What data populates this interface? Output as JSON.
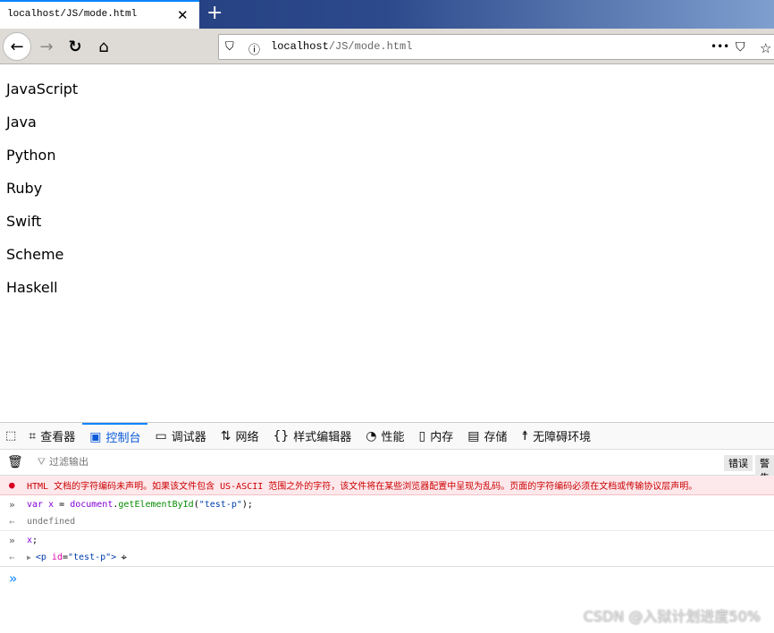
{
  "browser": {
    "tab_title": "localhost/JS/mode.html",
    "url_host": "localhost",
    "url_path": "/JS/mode.html"
  },
  "page": {
    "items": [
      "JavaScript",
      "Java",
      "Python",
      "Ruby",
      "Swift",
      "Scheme",
      "Haskell"
    ]
  },
  "devtools": {
    "tabs": [
      {
        "label": "查看器",
        "icon": "inspector-icon"
      },
      {
        "label": "控制台",
        "icon": "console-icon"
      },
      {
        "label": "调试器",
        "icon": "debugger-icon"
      },
      {
        "label": "网络",
        "icon": "network-icon"
      },
      {
        "label": "样式编辑器",
        "icon": "style-editor-icon"
      },
      {
        "label": "性能",
        "icon": "performance-icon"
      },
      {
        "label": "内存",
        "icon": "memory-icon"
      },
      {
        "label": "存储",
        "icon": "storage-icon"
      },
      {
        "label": "无障碍环境",
        "icon": "accessibility-icon"
      }
    ],
    "active_tab": "控制台",
    "filter_placeholder": "过滤输出",
    "filter_buttons": [
      "错误",
      "警告"
    ],
    "error": "HTML 文档的字符编码未声明。如果该文件包含 US-ASCII 范围之外的字符，该文件将在某些浏览器配置中呈现为乱码。页面的字符编码必须在文档或传输协议层声明。",
    "log": {
      "in1_var": "var",
      "in1_x": "x",
      "in1_eq": " = ",
      "in1_doc": "document",
      "in1_dot": ".",
      "in1_fn": "getElementById",
      "in1_open": "(",
      "in1_str": "\"test-p\"",
      "in1_close": ");",
      "out1": "undefined",
      "in2_x": "x",
      "in2_semi": ";",
      "out2_open": "<",
      "out2_tag": "p",
      "out2_attr": "id",
      "out2_eq": "=",
      "out2_val": "\"test-p\"",
      "out2_close": ">"
    }
  },
  "watermark": "CSDN @入狱计划进度50%"
}
